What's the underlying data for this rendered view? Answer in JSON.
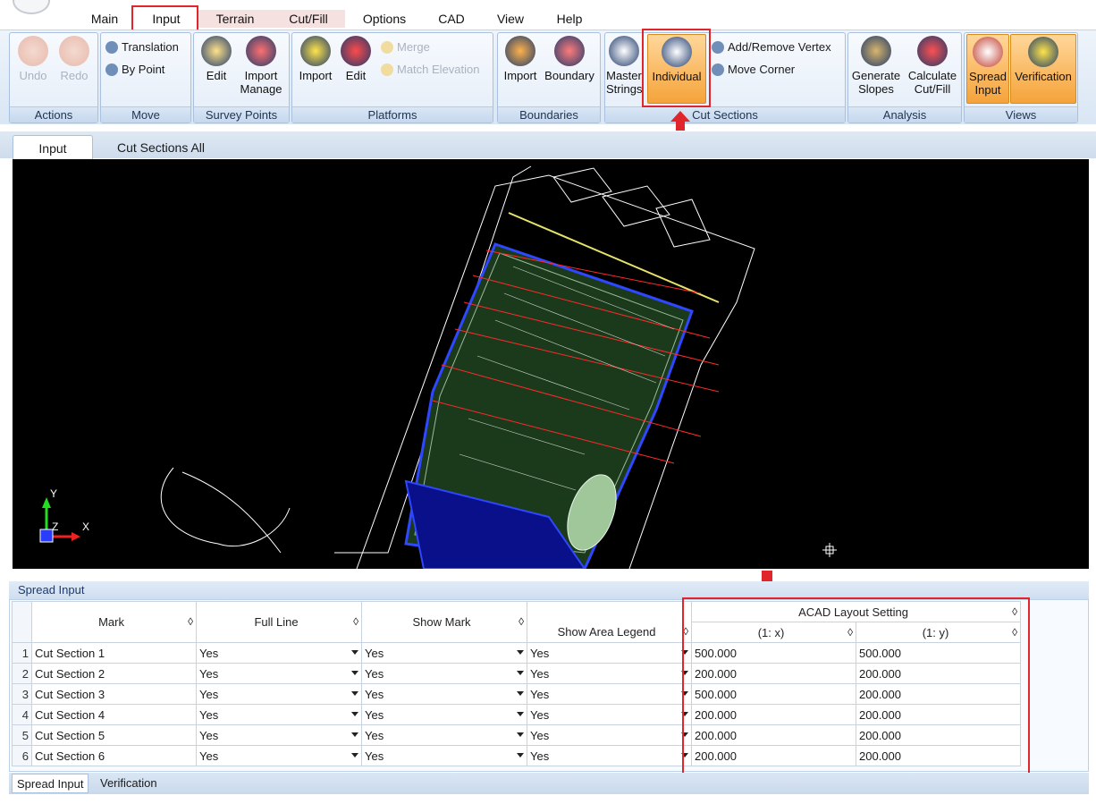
{
  "menu": {
    "tabs": [
      "Main",
      "Input",
      "Terrain",
      "Cut/Fill",
      "Options",
      "CAD",
      "View",
      "Help"
    ]
  },
  "ribbon": {
    "actions": {
      "label": "Actions",
      "undo": "Undo",
      "redo": "Redo"
    },
    "move": {
      "label": "Move",
      "translation": "Translation",
      "by_point": "By Point"
    },
    "survey_points": {
      "label": "Survey Points",
      "edit": "Edit",
      "import_manage_1": "Import",
      "import_manage_2": "Manage"
    },
    "platforms": {
      "label": "Platforms",
      "import": "Import",
      "edit": "Edit",
      "merge": "Merge",
      "match_elevation": "Match Elevation"
    },
    "boundaries": {
      "label": "Boundaries",
      "import": "Import",
      "boundary": "Boundary"
    },
    "cut_sections": {
      "label": "Cut Sections",
      "master_1": "Master",
      "master_2": "Strings",
      "individual": "Individual",
      "add_remove_vertex": "Add/Remove Vertex",
      "move_corner": "Move Corner"
    },
    "analysis": {
      "label": "Analysis",
      "generate_1": "Generate",
      "generate_2": "Slopes",
      "calculate_1": "Calculate",
      "calculate_2": "Cut/Fill"
    },
    "views": {
      "label": "Views",
      "spread_1": "Spread",
      "spread_2": "Input",
      "verification": "Verification"
    }
  },
  "doc_tabs": [
    "Input",
    "Cut Sections All"
  ],
  "spread": {
    "title": "Spread Input",
    "columns": {
      "mark": "Mark",
      "full_line": "Full Line",
      "show_mark": "Show Mark",
      "show_area_legend": "Show Area Legend",
      "acad_group": "ACAD Layout Setting",
      "x": "(1: x)",
      "y": "(1: y)"
    },
    "rows": [
      {
        "num": "1",
        "mark": "Cut Section 1",
        "full_line": "Yes",
        "show_mark": "Yes",
        "legend": "Yes",
        "x": "500.000",
        "y": "500.000"
      },
      {
        "num": "2",
        "mark": "Cut Section 2",
        "full_line": "Yes",
        "show_mark": "Yes",
        "legend": "Yes",
        "x": "200.000",
        "y": "200.000"
      },
      {
        "num": "3",
        "mark": "Cut Section 3",
        "full_line": "Yes",
        "show_mark": "Yes",
        "legend": "Yes",
        "x": "500.000",
        "y": "200.000"
      },
      {
        "num": "4",
        "mark": "Cut Section 4",
        "full_line": "Yes",
        "show_mark": "Yes",
        "legend": "Yes",
        "x": "200.000",
        "y": "200.000"
      },
      {
        "num": "5",
        "mark": "Cut Section 5",
        "full_line": "Yes",
        "show_mark": "Yes",
        "legend": "Yes",
        "x": "200.000",
        "y": "200.000"
      },
      {
        "num": "6",
        "mark": "Cut Section 6",
        "full_line": "Yes",
        "show_mark": "Yes",
        "legend": "Yes",
        "x": "200.000",
        "y": "200.000"
      }
    ]
  },
  "bottom_tabs": [
    "Spread Input",
    "Verification"
  ],
  "cad": {
    "axis_y": "Y",
    "axis_z": "Z",
    "axis_x": "X"
  },
  "colors": {
    "highlight_red": "#e0262b",
    "canvas": "#000000",
    "section_line": "#ff2a2a"
  }
}
